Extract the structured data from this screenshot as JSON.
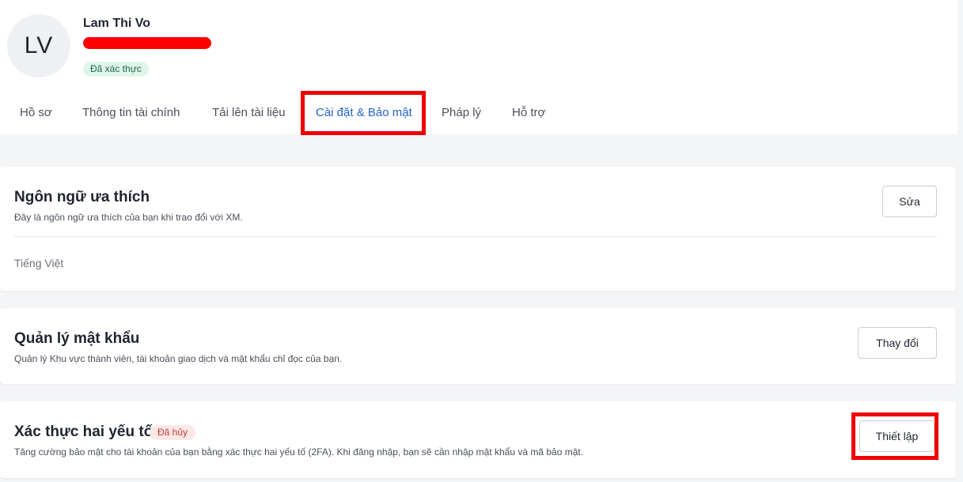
{
  "profile": {
    "initials": "LV",
    "name": "Lam Thi Vo",
    "status_badge": "Đã xác thực"
  },
  "tabs": [
    {
      "label": "Hồ sơ",
      "active": false
    },
    {
      "label": "Thông tin tài chính",
      "active": false
    },
    {
      "label": "Tải lên tài liệu",
      "active": false
    },
    {
      "label": "Cài đặt & Bảo mật",
      "active": true
    },
    {
      "label": "Pháp lý",
      "active": false
    },
    {
      "label": "Hỗ trợ",
      "active": false
    }
  ],
  "language_card": {
    "title": "Ngôn ngữ ưa thích",
    "description": "Đây là ngôn ngữ ưa thích của bạn khi trao đổi với XM.",
    "button_label": "Sửa",
    "value": "Tiếng Việt"
  },
  "password_card": {
    "title": "Quản lý mật khẩu",
    "description": "Quản lý Khu vực thành viên, tài khoản giao dịch và mật khẩu chỉ đọc của bạn.",
    "button_label": "Thay đổi"
  },
  "twofa_card": {
    "title": "Xác thực hai yếu tố",
    "status_badge": "Đã hủy",
    "description": "Tăng cường bảo mật cho tài khoản của bạn bằng xác thực hai yếu tố (2FA). Khi đăng nhập, bạn sẽ cần nhập mật khẩu và mã bảo mật.",
    "button_label": "Thiết lập"
  },
  "colors": {
    "accent": "#2563c9",
    "highlight": "#ee0000",
    "verified_bg": "#dff5ea",
    "cancelled_bg": "#fde8e8"
  }
}
